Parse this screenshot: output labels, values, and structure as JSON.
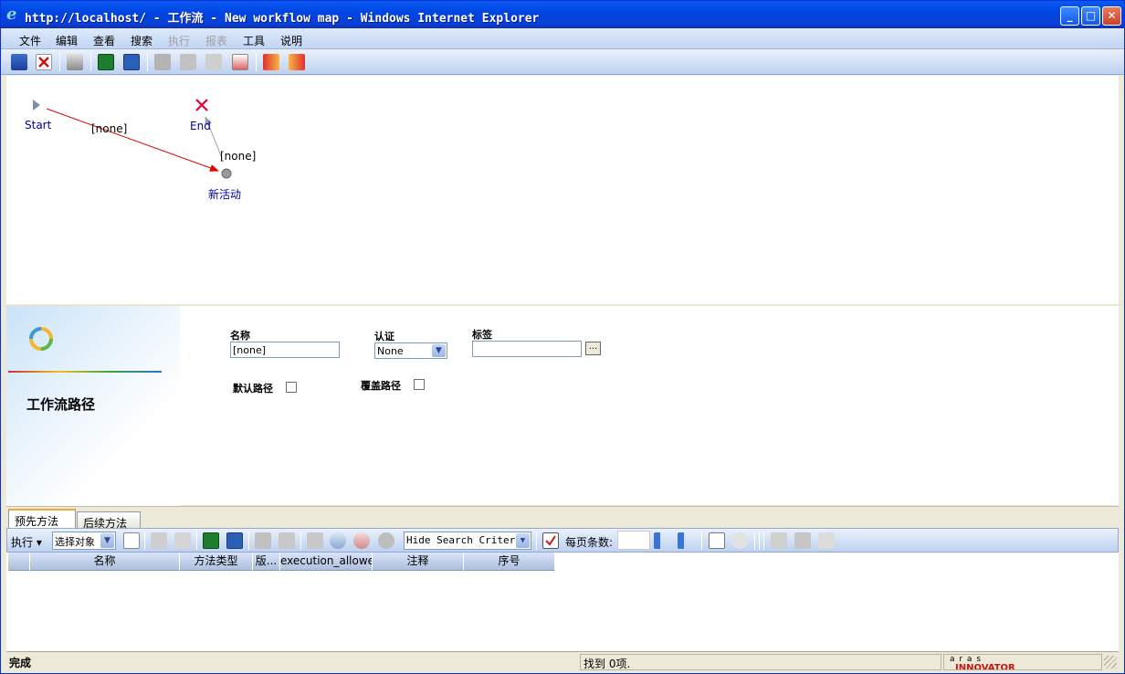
{
  "window": {
    "title": "http://localhost/ - 工作流 - New workflow map - Windows Internet Explorer",
    "minimize_glyph": "_",
    "maximize_glyph": "□",
    "close_glyph": "✕"
  },
  "menu": {
    "items": [
      {
        "label": "文件",
        "enabled": true
      },
      {
        "label": "编辑",
        "enabled": true
      },
      {
        "label": "查看",
        "enabled": true
      },
      {
        "label": "搜索",
        "enabled": true
      },
      {
        "label": "执行",
        "enabled": false
      },
      {
        "label": "报表",
        "enabled": false
      },
      {
        "label": "工具",
        "enabled": true
      },
      {
        "label": "说明",
        "enabled": true
      }
    ]
  },
  "toolbar": {
    "icons": [
      "save-icon",
      "delete-icon",
      "print-icon",
      "excel-icon",
      "word-icon",
      "lock-icon",
      "unlock-icon",
      "undo-icon",
      "promote-icon",
      "export-icon",
      "exit-icon"
    ]
  },
  "workflow": {
    "start_label": "Start",
    "end_label": "End",
    "activity_label": "新活动",
    "path_label_1": "[none]",
    "path_label_2": "[none]",
    "path_color": "#e00000"
  },
  "form": {
    "heading": "工作流路径",
    "name_caption": "名称",
    "name_value": "[none]",
    "auth_caption": "认证",
    "auth_value": "None",
    "label_caption": "标签",
    "label_value": "",
    "browse_label": "...",
    "default_path_caption": "默认路径",
    "override_path_caption": "覆盖路径"
  },
  "tabs": [
    {
      "label": "预先方法",
      "active": true
    },
    {
      "label": "后续方法",
      "active": false
    }
  ],
  "grid_toolbar": {
    "execute_label": "执行",
    "select_label": "选择对象",
    "search_mode": "Hide Search Criteria",
    "page_size_label": "每页条数:",
    "page_size_value": ""
  },
  "grid": {
    "columns": [
      "",
      "名称",
      "方法类型",
      "版...",
      "execution_allowe...",
      "注释",
      "序号"
    ]
  },
  "status": {
    "left": "完成",
    "middle": "找到 0项.",
    "brand_top": "a r a s",
    "brand_bottom": "INNOVATOR",
    "brand_color": "#cc1111"
  }
}
